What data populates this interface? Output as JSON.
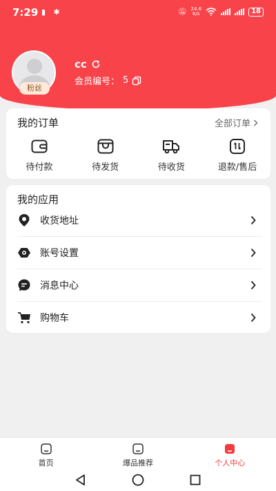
{
  "status_bar": {
    "time": "7:29",
    "net_speed_value": "24.6",
    "net_speed_unit": "K/s",
    "battery": "18"
  },
  "profile": {
    "username": "cc",
    "member_label": "会员编号：",
    "member_number": "5",
    "badge": "粉丝"
  },
  "orders": {
    "title": "我的订单",
    "all_link": "全部订单",
    "items": [
      {
        "label": "待付款",
        "icon": "wallet-icon"
      },
      {
        "label": "待发货",
        "icon": "package-icon"
      },
      {
        "label": "待收货",
        "icon": "truck-icon"
      },
      {
        "label": "退款/售后",
        "icon": "refund-icon"
      }
    ]
  },
  "apps": {
    "title": "我的应用",
    "items": [
      {
        "label": "收货地址",
        "icon": "location-pin-icon"
      },
      {
        "label": "账号设置",
        "icon": "eye-settings-icon"
      },
      {
        "label": "消息中心",
        "icon": "message-icon"
      },
      {
        "label": "购物车",
        "icon": "cart-icon"
      }
    ]
  },
  "tabbar": {
    "items": [
      {
        "label": "首页",
        "active": false
      },
      {
        "label": "爆品推荐",
        "active": false
      },
      {
        "label": "个人中心",
        "active": true
      }
    ]
  },
  "colors": {
    "brand_red": "#f8434a",
    "active_tab": "#f23a3f"
  }
}
